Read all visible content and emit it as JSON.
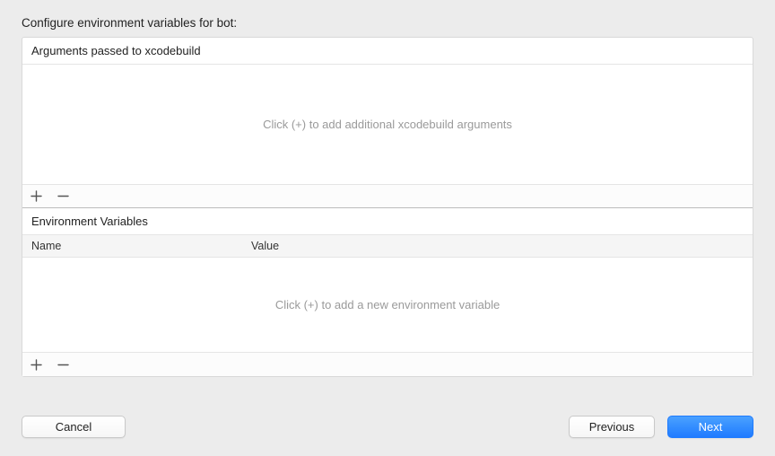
{
  "title": "Configure environment variables for bot:",
  "arguments_section": {
    "header": "Arguments passed to xcodebuild",
    "placeholder": "Click (+) to add additional xcodebuild arguments",
    "rows": []
  },
  "env_section": {
    "header": "Environment Variables",
    "columns": {
      "name": "Name",
      "value": "Value"
    },
    "placeholder": "Click (+) to add a new environment variable",
    "rows": []
  },
  "buttons": {
    "cancel": "Cancel",
    "previous": "Previous",
    "next": "Next"
  }
}
